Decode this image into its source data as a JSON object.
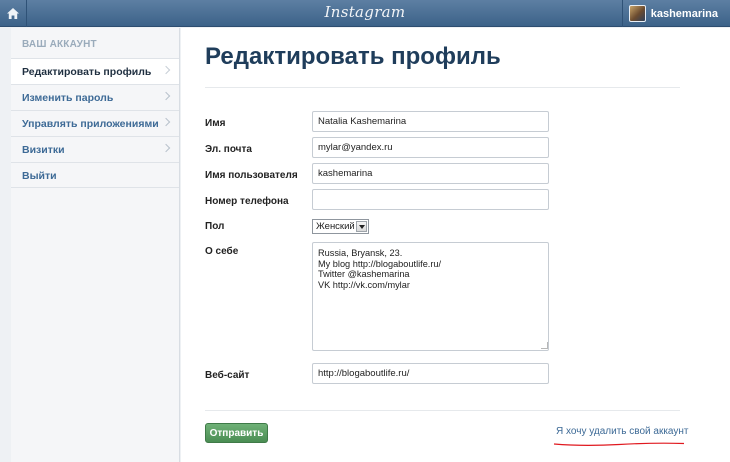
{
  "topbar": {
    "logo": "Instagram",
    "username": "kashemarina"
  },
  "sidebar": {
    "heading": "ВАШ АККАУНТ",
    "items": [
      {
        "label": "Редактировать профиль"
      },
      {
        "label": "Изменить пароль"
      },
      {
        "label": "Управлять приложениями"
      },
      {
        "label": "Визитки"
      },
      {
        "label": "Выйти"
      }
    ]
  },
  "main": {
    "title": "Редактировать профиль",
    "fields": {
      "name": {
        "label": "Имя",
        "value": "Natalia Kashemarina"
      },
      "email": {
        "label": "Эл. почта",
        "value": "mylar@yandex.ru"
      },
      "username": {
        "label": "Имя пользователя",
        "value": "kashemarina"
      },
      "phone": {
        "label": "Номер телефона",
        "value": ""
      },
      "gender": {
        "label": "Пол",
        "value": "Женский"
      },
      "bio": {
        "label": "О себе",
        "value": "Russia, Bryansk, 23.\nMy blog http://blogaboutlife.ru/\nTwitter @kashemarina\nVK http://vk.com/mylar"
      },
      "website": {
        "label": "Веб-сайт",
        "value": "http://blogaboutlife.ru/"
      }
    },
    "submit_label": "Отправить",
    "delete_link": "Я хочу удалить свой аккаунт"
  },
  "colors": {
    "accent": "#3d6a96",
    "title": "#1f3d5b",
    "submit": "#4a8d53",
    "annotation": "#e0191f"
  },
  "icons": {
    "home": "home-icon",
    "chevron": "chevron-right-icon"
  }
}
